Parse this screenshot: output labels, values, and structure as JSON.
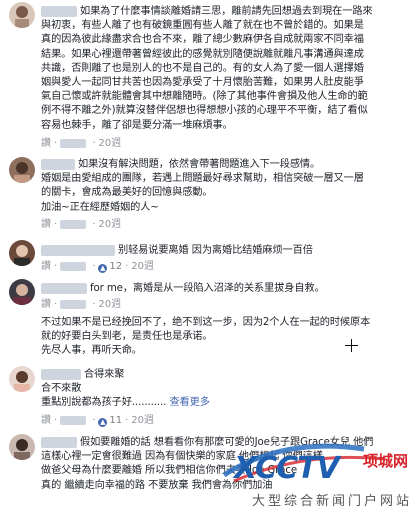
{
  "comments": [
    {
      "lines": [
        "如果為了什麼事情談離婚請三思，離前請先回想過去到現在一路來",
        "與初衷，有些人離了也有破鏡重圓有些人離了就在也不曾於錯的。如果是",
        "真的因為彼此緣盡求合也合不來，離了總少數麻伊各自成就兩家不同幸福",
        "結果。如果心裡還帶著曾經彼此的感覺就別隨便說離就離凡事溝通與達成",
        "共識，否則離了也是別人的也不是自己的。有的女人為了愛一個人選擇婚",
        "姻與愛人一起同甘共苦也因為愛承受了十月懷胎苦難，如果男人肚皮能爭",
        "氣自己懷或許就能體會其中想離隨時。(除了其他事件會損及他人生命的範",
        "例不得不離之外)就算沒替伴侶想也得想想小孩的心理平不平衡，結了看似",
        "容易也棘手，離了卻是要分滿一堆麻煩事。"
      ],
      "action": "讚",
      "time": "20週"
    },
    {
      "lines": [
        "如果沒有解決問題，依然會帶著問題進入下一段感情。",
        "婚姻是由愛組成的團隊，若遇上問題最好尋求幫助，相信突破一層又一層",
        "的關卡，會成為最美好的回憶與感動。",
        "加油~正在經歷婚姻的人~"
      ],
      "action": "讚",
      "time": "20週"
    },
    {
      "lines": [
        "别轻易说要离婚 因为离婚比结婚麻烦一百倍"
      ],
      "action": "讚",
      "likes": "12",
      "time": "20週"
    },
    {
      "lines": [
        "for me，离婚是从一段陷入沼泽的关系里拔身自救。"
      ],
      "action": "讚",
      "time": "20週"
    },
    {
      "lines": [
        "不过如果不是已经挽回不了，绝不到这一步，因为2个人在一起的时候原本",
        "就的好要白头到老，是责任也是承诺。",
        "先尽人事，再听天命。"
      ]
    },
    {
      "lines": [
        "合得來聚",
        "合不來散",
        "重點別說都為孩子好..........."
      ],
      "see_more": "查看更多",
      "action": "讚",
      "likes": "11",
      "time": "20週"
    },
    {
      "lines": [
        "假如要離婚的話 想看看你有那麼可愛的Joe兒子跟Grace女兒 他們",
        "這樣心裡一定會很難過 因為有個快樂的家庭 他們想起 你們這樣",
        "做爸父母為什麼要離婚 所以我們相信你們夫妻 Joe Grace",
        "真的 繼續走向幸福的路 不要放棄 我們會為你們加油"
      ]
    }
  ],
  "watermark": {
    "logo": "XCCTV",
    "tagline": "项城网",
    "subtitle": "大型综合新闻门户网站"
  }
}
